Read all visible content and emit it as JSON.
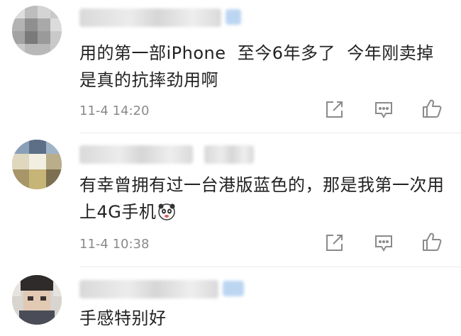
{
  "comments": [
    {
      "author": "",
      "text": "用的第一部iPhone  至今6年多了  今年刚卖掉 是真的抗摔劲用啊",
      "time": "11-4 14:20",
      "has_emoji": false
    },
    {
      "author": "",
      "text": "有幸曾拥有过一台港版蓝色的，那是我第一次用上4G手机",
      "time": "11-4 10:38",
      "has_emoji": true,
      "emoji_name": "panda-emoji"
    },
    {
      "author": "",
      "text": "手感特别好",
      "time": "",
      "has_emoji": false
    }
  ],
  "actions": [
    "share-icon",
    "reply-icon",
    "like-icon"
  ],
  "colors": {
    "text": "#222222",
    "time": "#8a8a8a",
    "icon": "#8a8a8a",
    "divider": "#ececec"
  }
}
